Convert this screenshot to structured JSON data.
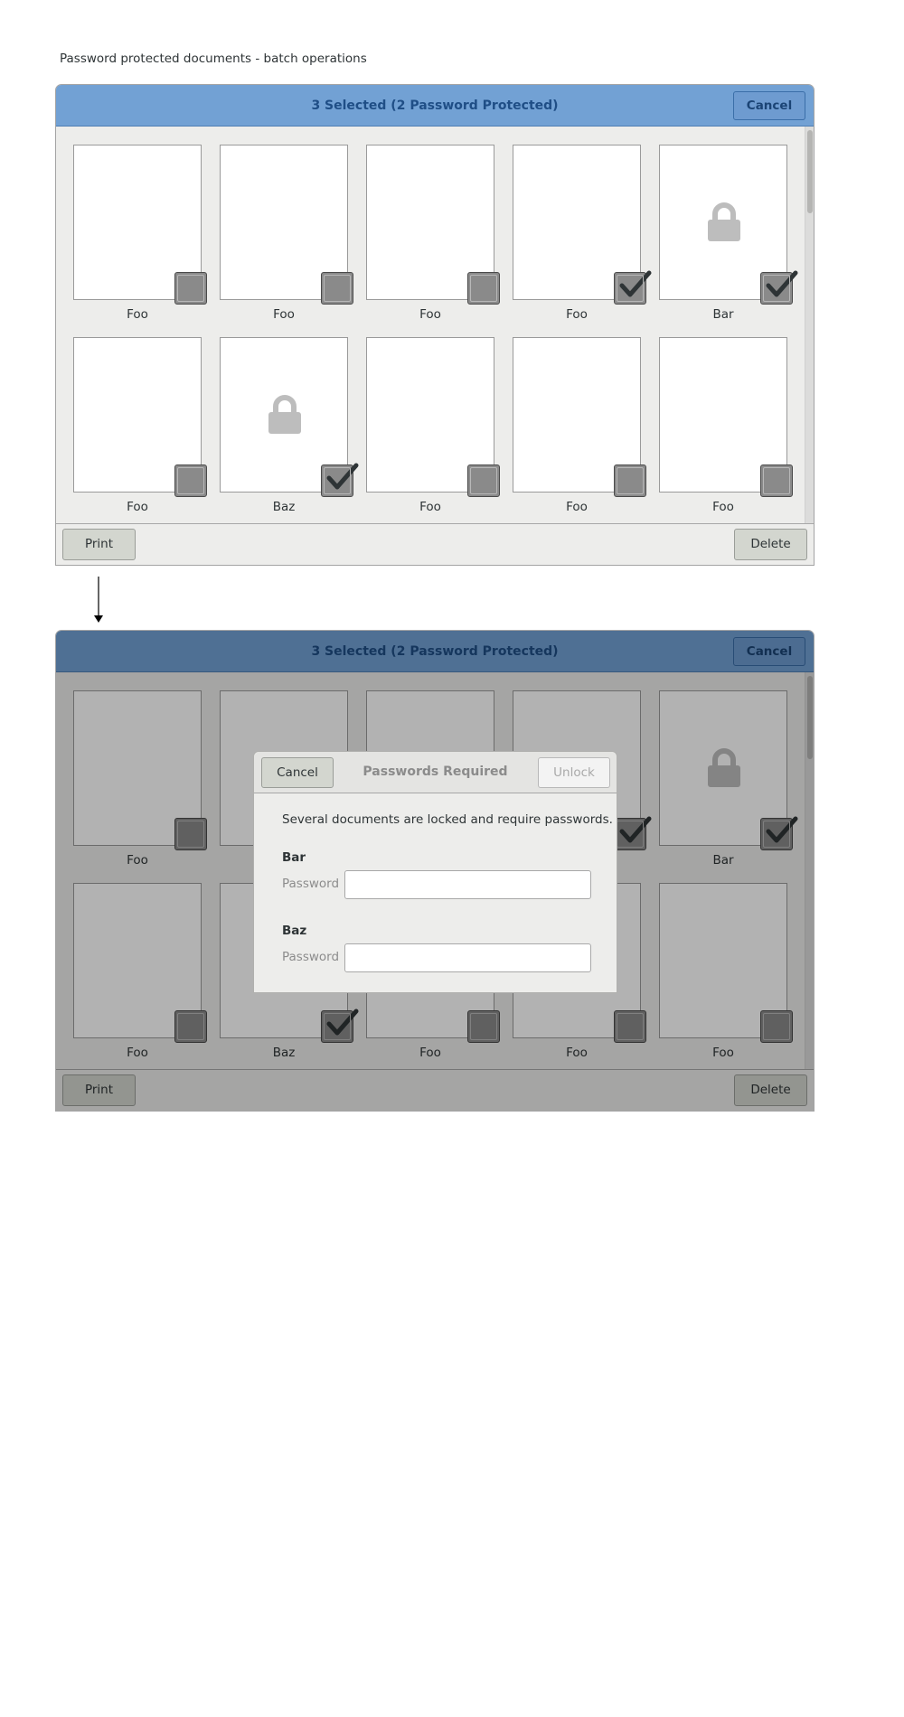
{
  "page_title": "Password protected documents - batch operations",
  "screen1": {
    "header": {
      "title": "3 Selected (2 Password Protected)",
      "cancel_label": "Cancel"
    },
    "documents": [
      {
        "name": "Foo",
        "checked": false,
        "locked": false
      },
      {
        "name": "Foo",
        "checked": false,
        "locked": false
      },
      {
        "name": "Foo",
        "checked": false,
        "locked": false
      },
      {
        "name": "Foo",
        "checked": true,
        "locked": false
      },
      {
        "name": "Bar",
        "checked": true,
        "locked": true
      },
      {
        "name": "Foo",
        "checked": false,
        "locked": false
      },
      {
        "name": "Baz",
        "checked": true,
        "locked": true
      },
      {
        "name": "Foo",
        "checked": false,
        "locked": false
      },
      {
        "name": "Foo",
        "checked": false,
        "locked": false
      },
      {
        "name": "Foo",
        "checked": false,
        "locked": false
      }
    ],
    "actions": {
      "print_label": "Print",
      "delete_label": "Delete"
    }
  },
  "screen2": {
    "header": {
      "title": "3 Selected (2 Password Protected)",
      "cancel_label": "Cancel"
    },
    "documents": [
      {
        "name": "Foo",
        "checked": false,
        "locked": false
      },
      {
        "name": "",
        "checked": false,
        "locked": false
      },
      {
        "name": "",
        "checked": false,
        "locked": false
      },
      {
        "name": "",
        "checked": true,
        "locked": false
      },
      {
        "name": "Bar",
        "checked": true,
        "locked": true
      },
      {
        "name": "Foo",
        "checked": false,
        "locked": false
      },
      {
        "name": "Baz",
        "checked": true,
        "locked": false
      },
      {
        "name": "Foo",
        "checked": false,
        "locked": false
      },
      {
        "name": "Foo",
        "checked": false,
        "locked": false
      },
      {
        "name": "Foo",
        "checked": false,
        "locked": false
      }
    ],
    "actions": {
      "print_label": "Print",
      "delete_label": "Delete"
    },
    "dialog": {
      "cancel_label": "Cancel",
      "title": "Passwords Required",
      "unlock_label": "Unlock",
      "message": "Several documents are locked and require passwords.",
      "fields": [
        {
          "document": "Bar",
          "label": "Password",
          "value": ""
        },
        {
          "document": "Baz",
          "label": "Password",
          "value": ""
        }
      ]
    }
  },
  "colors": {
    "header_bg": "#72a1d4",
    "header_title": "#1f4e86",
    "window_bg": "#ededeb",
    "checkbox_bg": "#8a8a8a"
  },
  "icons": {
    "lock": "lock-icon",
    "checkmark": "checkmark-icon",
    "arrow": "arrow-down-icon"
  }
}
